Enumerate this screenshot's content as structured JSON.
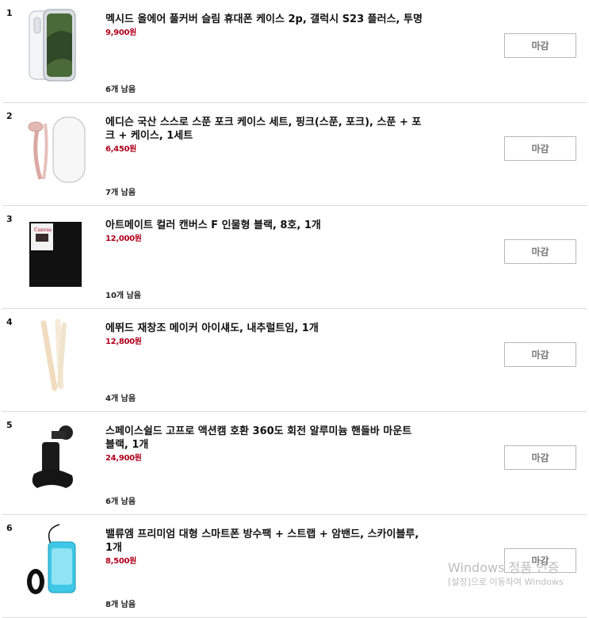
{
  "products": [
    {
      "rank": "1",
      "title": "멕시드 올에어 풀커버 슬림 휴대폰 케이스 2p, 갤럭시 S23 플러스, 투명",
      "price": "9,900원",
      "stock": "6개 남음",
      "button": "마감",
      "image": "clear-phone-case"
    },
    {
      "rank": "2",
      "title": "에디슨 국산 스스로 스푼 포크 케이스 세트, 핑크(스푼, 포크), 스푼 + 포크 + 케이스, 1세트",
      "price": "6,450원",
      "stock": "7개 남음",
      "button": "마감",
      "image": "spoon-fork-case"
    },
    {
      "rank": "3",
      "title": "아트메이트 컬러 캔버스 F 인물형 블랙, 8호, 1개",
      "price": "12,000원",
      "stock": "10개 남음",
      "button": "마감",
      "image": "black-canvas"
    },
    {
      "rank": "4",
      "title": "에뛰드 재창조 메이커 아이섀도, 내추럴트임, 1개",
      "price": "12,800원",
      "stock": "4개 남음",
      "button": "마감",
      "image": "eyeshadow-pencil"
    },
    {
      "rank": "5",
      "title": "스페이스쉴드 고프로 액션캠 호환 360도 회전 알루미늄 핸들바 마운트 블랙, 1개",
      "price": "24,900원",
      "stock": "6개 남음",
      "button": "마감",
      "image": "handlebar-mount"
    },
    {
      "rank": "6",
      "title": "밸류엠 프리미엄 대형 스마트폰 방수팩 + 스트랩 + 암밴드, 스카이블루, 1개",
      "price": "8,500원",
      "stock": "8개 남음",
      "button": "마감",
      "image": "waterproof-pouch"
    }
  ],
  "watermark": {
    "line1": "Windows 정품 인증",
    "line2": "[설정]으로 이동하여 Windows"
  }
}
